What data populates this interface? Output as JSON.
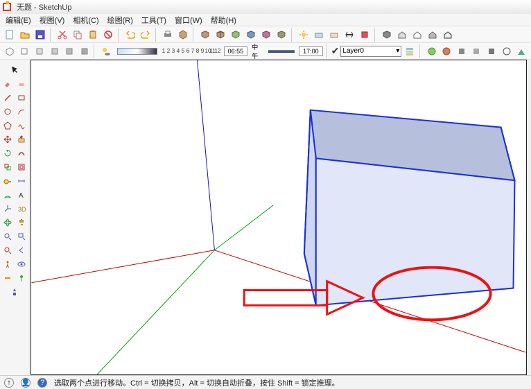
{
  "title": "无题 - SketchUp",
  "menu": {
    "edit": "编辑(E)",
    "view": "视图(V)",
    "camera": "相机(C)",
    "draw": "绘图(R)",
    "tools": "工具(T)",
    "window": "窗口(W)",
    "help": "帮助(H)"
  },
  "toolbar1": {
    "icons": [
      "new",
      "open",
      "save",
      "cut",
      "copy",
      "paste",
      "delete",
      "undo",
      "redo",
      "print",
      "model",
      "group1",
      "group2",
      "group3",
      "group4",
      "group5",
      "group6",
      "solar",
      "solar2",
      "solar3",
      "section",
      "solid",
      "house1",
      "house2",
      "house3",
      "house4",
      "house5"
    ]
  },
  "toolbar2": {
    "icons": [
      "view1",
      "view2",
      "view3",
      "view4",
      "view5",
      "view6"
    ],
    "shadow_toggle": "shadow",
    "ticks": [
      "1",
      "2",
      "3",
      "4",
      "5",
      "6",
      "7",
      "8",
      "9",
      "10",
      "11",
      "12"
    ],
    "time1": "06:55",
    "noon": "中午",
    "time2": "17:00",
    "layer_check": true,
    "layer_name": "Layer0",
    "layer_icons": [
      "layer-dd",
      "layer-vis"
    ],
    "right_icons": [
      "g1",
      "g2",
      "g3",
      "g4",
      "g5",
      "g6",
      "g7",
      "g8",
      "g9"
    ]
  },
  "left_tools": {
    "pairs": [
      [
        "select",
        "eraser"
      ],
      [
        "paint",
        "line"
      ],
      [
        "rect",
        "arc"
      ],
      [
        "freehand",
        "circle"
      ],
      [
        "polygon",
        "arc2"
      ],
      [
        "curve",
        "move"
      ],
      [
        "pushpull",
        "rotate"
      ],
      [
        "followme",
        "scale"
      ],
      [
        "offset",
        "tape"
      ],
      [
        "protractor",
        "dim"
      ],
      [
        "text",
        "axes"
      ],
      [
        "3dtext",
        "orbit"
      ],
      [
        "pan",
        "zoom"
      ],
      [
        "zoomwin",
        "zoomext"
      ],
      [
        "prev",
        "walk"
      ],
      [
        "look",
        "section"
      ],
      [
        "pos1",
        "pos2"
      ]
    ]
  },
  "status": {
    "hint": "选取两个点进行移动。Ctrl = 切换拷贝，Alt = 切换自动折叠，按住 Shift = 锁定推理。"
  },
  "viewport": {
    "axes": {
      "red": "#c00",
      "green": "#0a0",
      "blue": "#00c"
    },
    "cube_color": "#1a2fd8",
    "cube_fill_top": "#9aa6d6",
    "cube_fill_side": "#d9dff5",
    "annot_color": "#e11"
  }
}
